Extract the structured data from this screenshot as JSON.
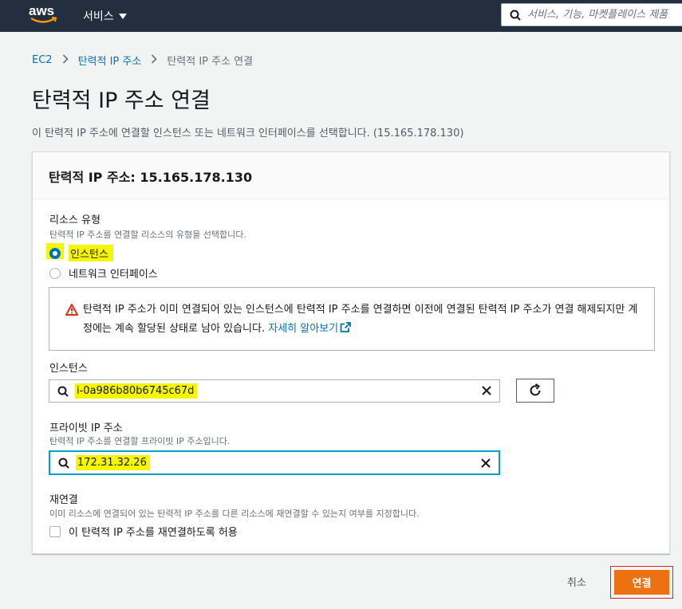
{
  "nav": {
    "logo_text": "aws",
    "services_label": "서비스",
    "search_placeholder": "서비스, 기능, 마켓플레이스 제품"
  },
  "breadcrumb": [
    "EC2",
    "탄력적 IP 주소",
    "탄력적 IP 주소 연결"
  ],
  "page": {
    "title": "탄력적 IP 주소 연결",
    "description": "이 탄력적 IP 주소에 연결할 인스턴스 또는 네트워크 인터페이스를 선택합니다. (15.165.178.130)"
  },
  "panel": {
    "header": "탄력적 IP 주소: 15.165.178.130",
    "resource_type": {
      "label": "리소스 유형",
      "description": "탄력적 IP 주소를 연결할 리소스의 유형을 선택합니다.",
      "options": [
        {
          "label": "인스턴스",
          "checked": true
        },
        {
          "label": "네트워크 인터페이스",
          "checked": false
        }
      ]
    },
    "alert": {
      "text": "탄력적 IP 주소가 이미 연결되어 있는 인스턴스에 탄력적 IP 주소를 연결하면 이전에 연결된 탄력적 IP 주소가 연결 해제되지만 계정에는 계속 할당된 상태로 남아 있습니다.",
      "link": "자세히 알아보기"
    },
    "instance": {
      "label": "인스턴스",
      "value": "i-0a986b80b6745c67d"
    },
    "private_ip": {
      "label": "프라이빗 IP 주소",
      "description": "탄력적 IP 주소를 연결할 프라이빗 IP 주소입니다.",
      "value": "172.31.32.26"
    },
    "reassociate": {
      "label": "재연결",
      "description": "이미 리소스에 연결되어 있는 탄력적 IP 주소를 다른 리소스에 재연결할 수 있는지 여부를 지정합니다.",
      "checkbox_label": "이 탄력적 IP 주소를 재연결하도록 허용"
    }
  },
  "actions": {
    "cancel": "취소",
    "connect": "연결"
  },
  "colors": {
    "nav_bg": "#232f3e",
    "link": "#0073bb",
    "primary": "#ec7211",
    "highlight": "#f6f600"
  }
}
